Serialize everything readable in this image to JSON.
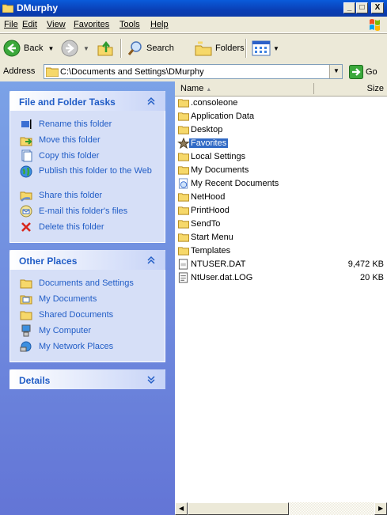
{
  "window": {
    "title": "DMurphy"
  },
  "menu": [
    "File",
    "Edit",
    "View",
    "Favorites",
    "Tools",
    "Help"
  ],
  "toolbar": {
    "back": "Back",
    "search": "Search",
    "folders": "Folders"
  },
  "address": {
    "label": "Address",
    "value": "C:\\Documents and Settings\\DMurphy",
    "go": "Go"
  },
  "tasks": {
    "title": "File and Folder Tasks",
    "items": [
      {
        "label": "Rename this folder",
        "icon": "rename-icon"
      },
      {
        "label": "Move this folder",
        "icon": "move-icon"
      },
      {
        "label": "Copy this folder",
        "icon": "copy-icon"
      },
      {
        "label": "Publish this folder to the Web",
        "icon": "globe-icon"
      },
      {
        "label": "Share this folder",
        "icon": "share-icon"
      },
      {
        "label": "E-mail this folder's files",
        "icon": "email-icon"
      },
      {
        "label": "Delete this folder",
        "icon": "delete-icon"
      }
    ]
  },
  "places": {
    "title": "Other Places",
    "items": [
      {
        "label": "Documents and Settings",
        "icon": "folder-icon"
      },
      {
        "label": "My Documents",
        "icon": "my-documents-icon"
      },
      {
        "label": "Shared Documents",
        "icon": "folder-icon"
      },
      {
        "label": "My Computer",
        "icon": "computer-icon"
      },
      {
        "label": "My Network Places",
        "icon": "network-icon"
      }
    ]
  },
  "details": {
    "title": "Details"
  },
  "columns": {
    "name": "Name",
    "size": "Size"
  },
  "files": [
    {
      "name": ".consoleone",
      "size": "",
      "type": "folder"
    },
    {
      "name": "Application Data",
      "size": "",
      "type": "folder"
    },
    {
      "name": "Desktop",
      "size": "",
      "type": "folder"
    },
    {
      "name": "Favorites",
      "size": "",
      "type": "favorites",
      "selected": true
    },
    {
      "name": "Local Settings",
      "size": "",
      "type": "folder"
    },
    {
      "name": "My Documents",
      "size": "",
      "type": "folder"
    },
    {
      "name": "My Recent Documents",
      "size": "",
      "type": "recent"
    },
    {
      "name": "NetHood",
      "size": "",
      "type": "folder"
    },
    {
      "name": "PrintHood",
      "size": "",
      "type": "folder"
    },
    {
      "name": "SendTo",
      "size": "",
      "type": "folder"
    },
    {
      "name": "Start Menu",
      "size": "",
      "type": "folder"
    },
    {
      "name": "Templates",
      "size": "",
      "type": "folder"
    },
    {
      "name": "NTUSER.DAT",
      "size": "9,472 KB",
      "type": "dat"
    },
    {
      "name": "NtUser.dat.LOG",
      "size": "20 KB",
      "type": "txt"
    }
  ],
  "colors": {
    "titlebar": "#0A3FB6",
    "taskpane_link": "#215DC6",
    "selection": "#316AC5"
  }
}
